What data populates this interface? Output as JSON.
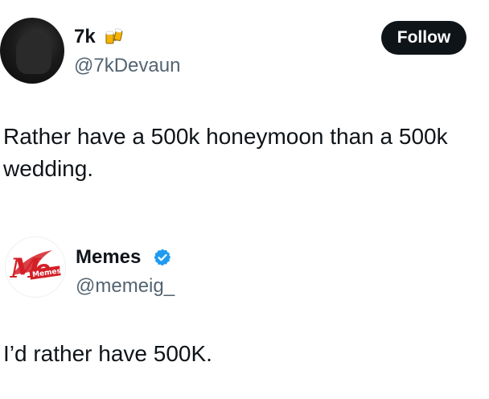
{
  "post1": {
    "display_name": "7k",
    "name_emoji": "beer-mugs-emoji",
    "handle": "@7kDevaun",
    "follow_label": "Follow",
    "text": "Rather have a 500k honeymoon than a 500k wedding."
  },
  "post2": {
    "display_name": "Memes",
    "verified_icon": "verified-badge-icon",
    "handle": "@memeig_",
    "logo_text": "Memes",
    "text": "I’d rather have 500K."
  },
  "colors": {
    "text_primary": "#0f1419",
    "text_secondary": "#536471",
    "button_bg": "#0f1419",
    "verified_blue": "#1d9bf0",
    "logo_red": "#d32027"
  }
}
